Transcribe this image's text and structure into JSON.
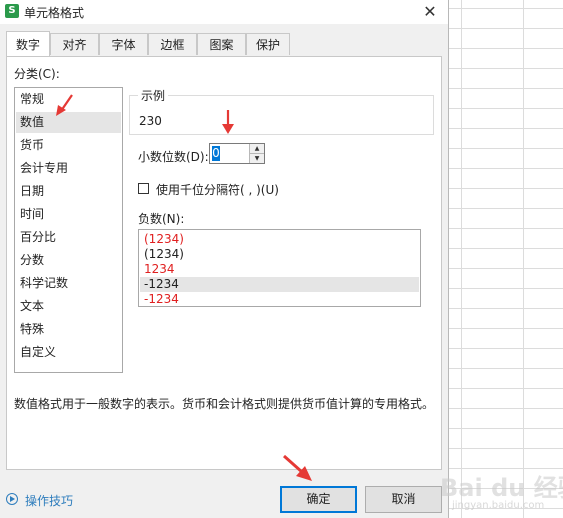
{
  "dialog": {
    "title": "单元格格式",
    "app_icon_letter": "S",
    "close_glyph": "✕"
  },
  "tabs": [
    {
      "label": "数字",
      "active": true
    },
    {
      "label": "对齐"
    },
    {
      "label": "字体"
    },
    {
      "label": "边框"
    },
    {
      "label": "图案"
    },
    {
      "label": "保护"
    }
  ],
  "category": {
    "label": "分类(C):",
    "items": [
      "常规",
      "数值",
      "货币",
      "会计专用",
      "日期",
      "时间",
      "百分比",
      "分数",
      "科学记数",
      "文本",
      "特殊",
      "自定义"
    ],
    "selected_index": 1
  },
  "sample": {
    "legend": "示例",
    "value": "230"
  },
  "decimal": {
    "label": "小数位数(D):",
    "value": "0"
  },
  "thousands": {
    "label": "使用千位分隔符( , )(U)",
    "checked": false
  },
  "negative": {
    "label": "负数(N):",
    "items": [
      {
        "text": "(1234)",
        "color": "#e02020"
      },
      {
        "text": "(1234)",
        "color": "#222222"
      },
      {
        "text": "1234",
        "color": "#e02020"
      },
      {
        "text": "-1234",
        "color": "#222222"
      },
      {
        "text": "-1234",
        "color": "#e02020"
      }
    ],
    "selected_index": 3
  },
  "description": "数值格式用于一般数字的表示。货币和会计格式则提供货币值计算的专用格式。",
  "tips_label": "操作技巧",
  "buttons": {
    "ok": "确定",
    "cancel": "取消"
  },
  "watermark": {
    "text": "Bai du 经验",
    "sub": "jingyan.baidu.com"
  },
  "colors": {
    "accent": "#0078d7",
    "annotation_arrow": "#e53935",
    "negative_red": "#e02020"
  }
}
